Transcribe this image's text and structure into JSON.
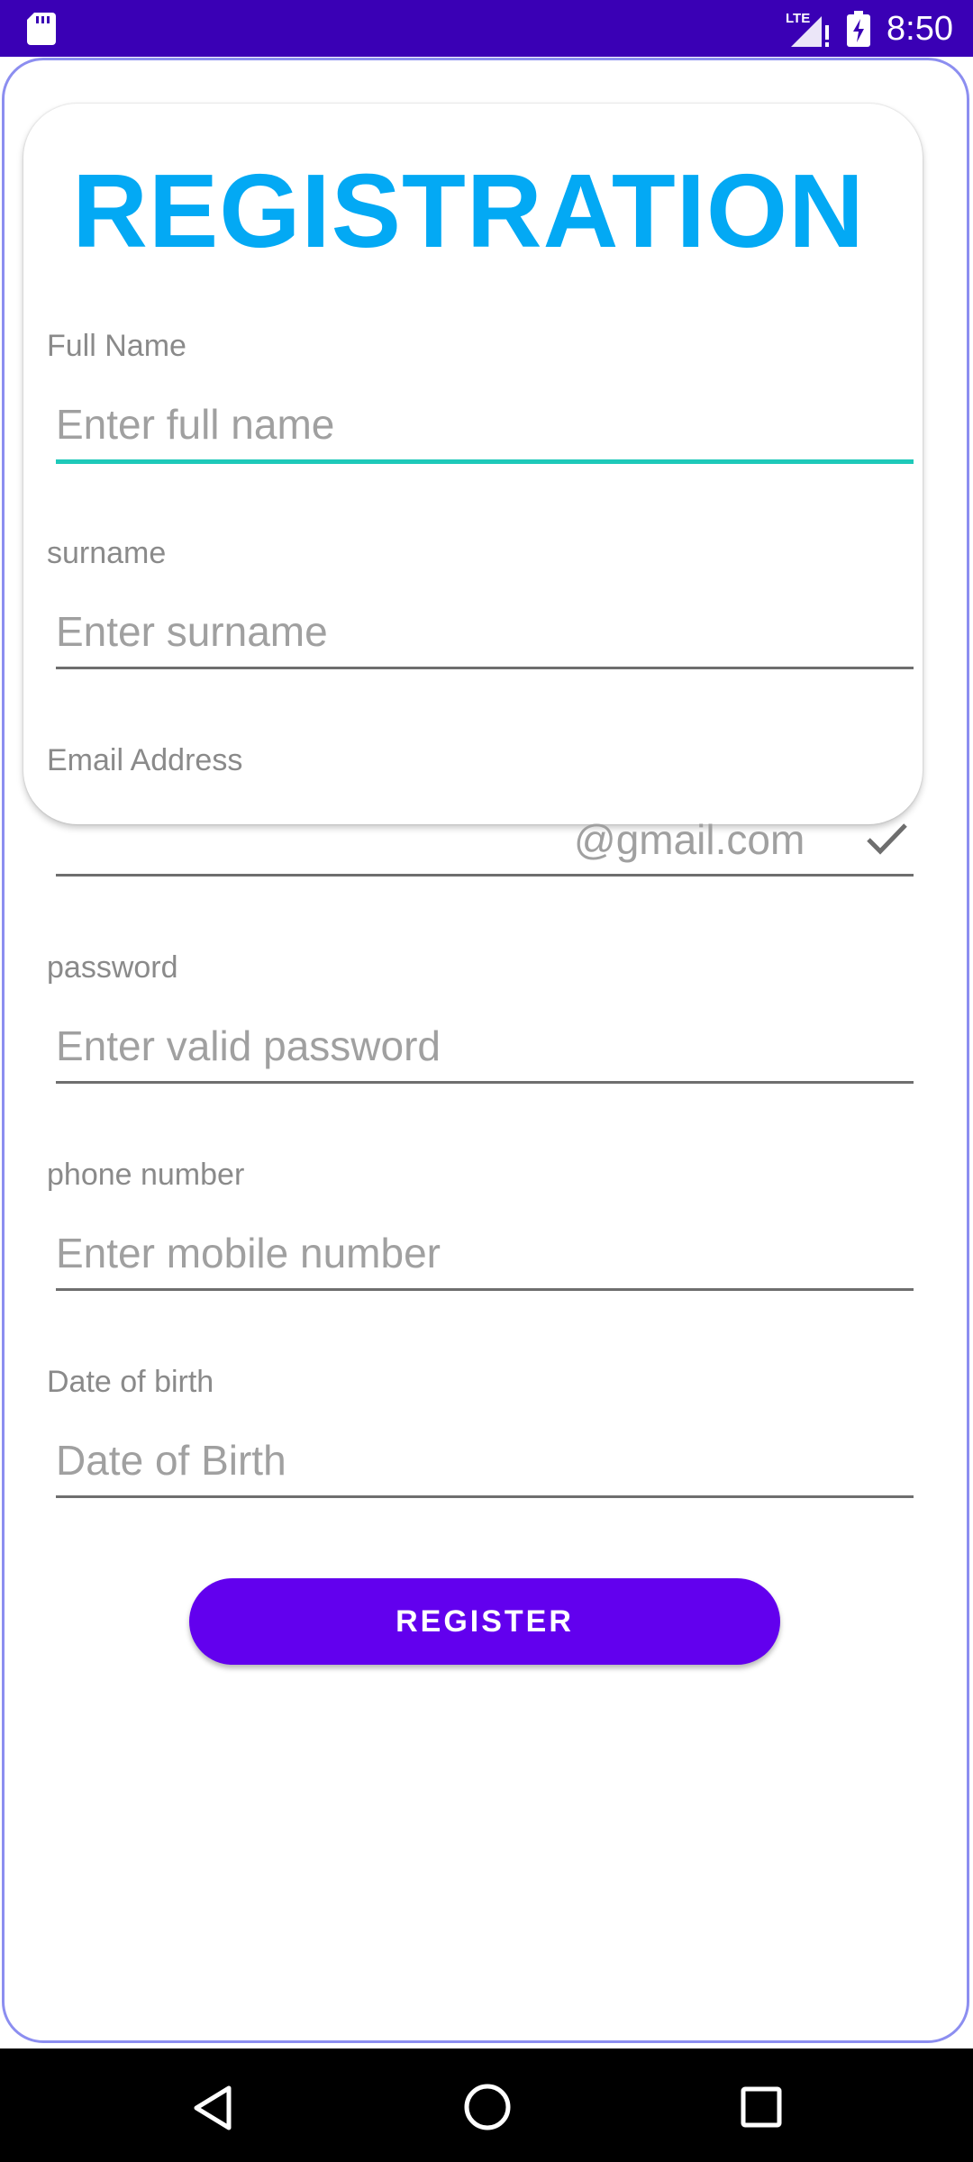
{
  "status_bar": {
    "time": "8:50",
    "network": "LTE",
    "icons": [
      "sd-card-icon",
      "lte-signal-icon",
      "battery-charging-icon"
    ],
    "background_color": "#3a00b5"
  },
  "form": {
    "title": "REGISTRATION",
    "title_color": "#03a9f4",
    "fields": [
      {
        "label": "Full Name",
        "placeholder": "Enter full name",
        "focused": true
      },
      {
        "label": "surname",
        "placeholder": "Enter surname"
      },
      {
        "label": "Email Address",
        "placeholder": "",
        "suffix": "@gmail.com",
        "end_icon": "check-icon"
      },
      {
        "label": "password",
        "placeholder": "Enter valid password"
      },
      {
        "label": "phone number",
        "placeholder": "Enter mobile number"
      },
      {
        "label": "Date of birth",
        "placeholder": "Date of Birth"
      }
    ],
    "register_label": "REGISTER",
    "register_color": "#6200ee",
    "focus_color": "#1ec9b9"
  },
  "nav_bar": {
    "buttons": [
      "back-icon",
      "home-icon",
      "recents-icon"
    ]
  }
}
